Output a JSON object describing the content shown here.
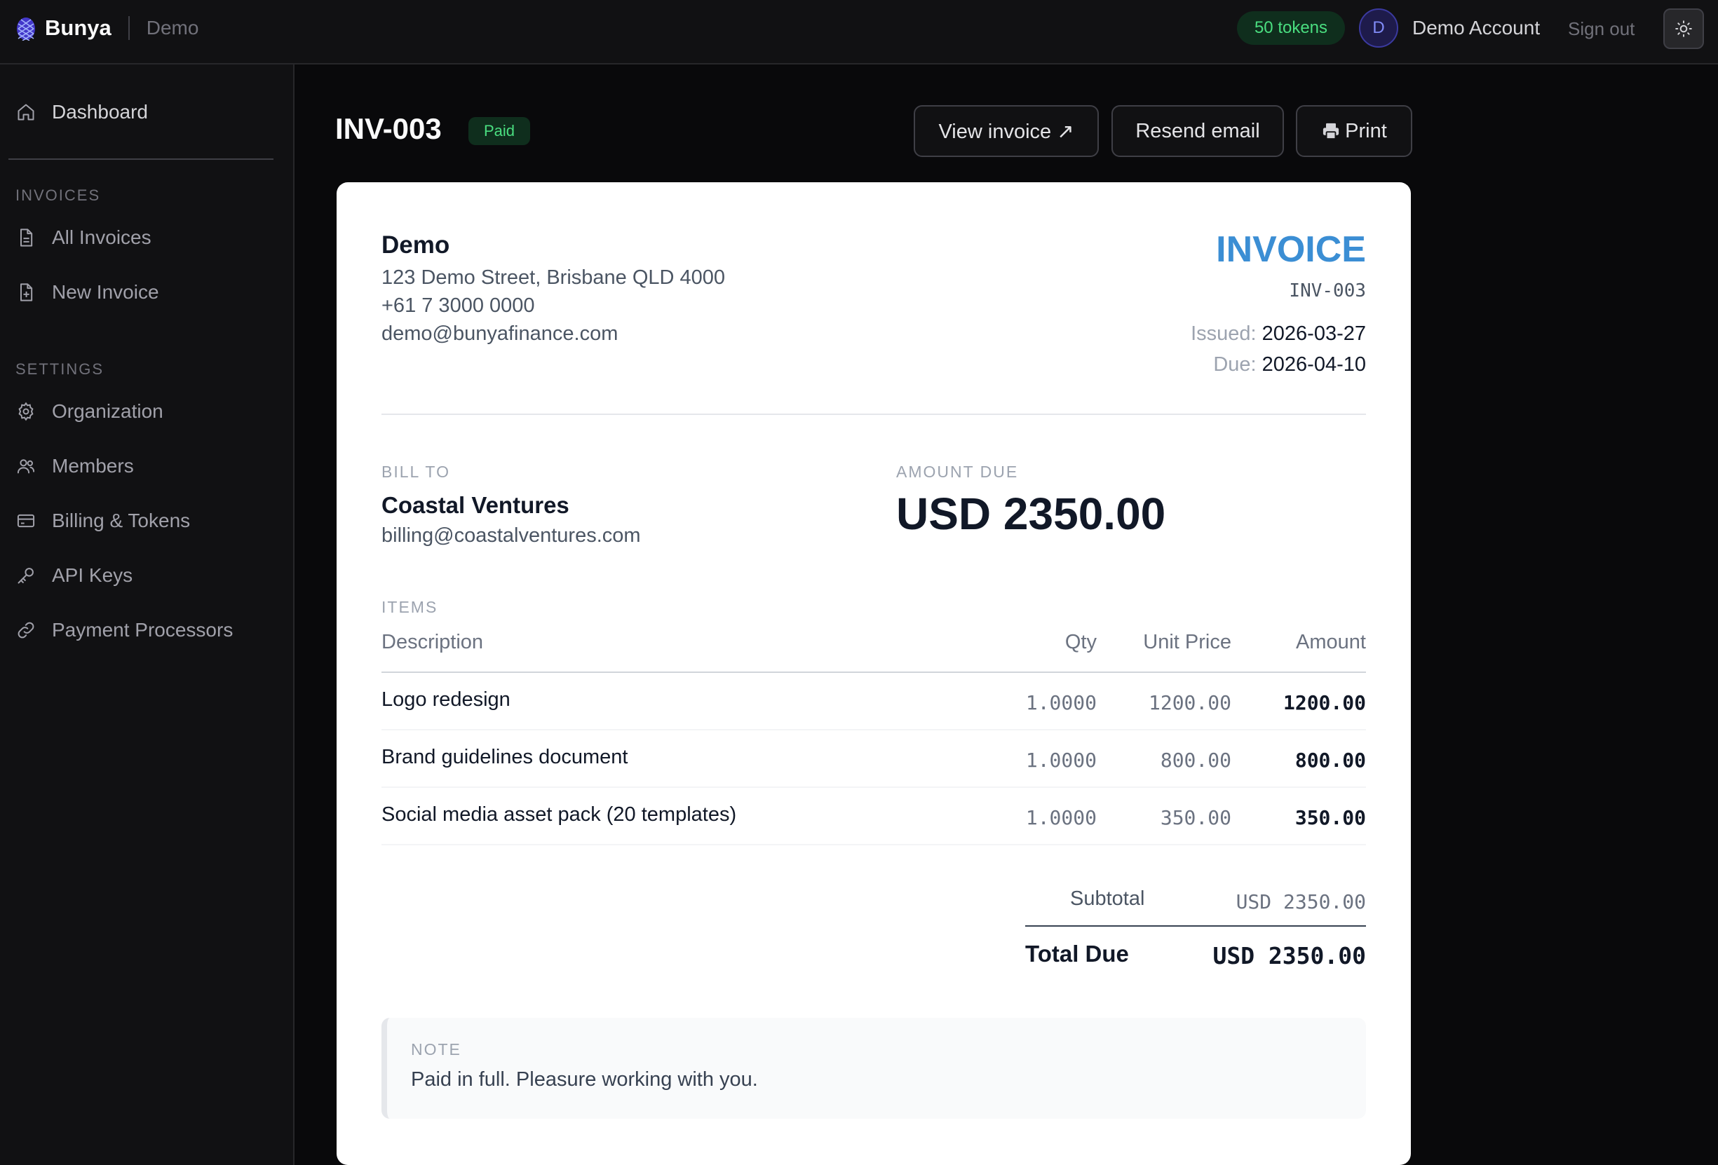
{
  "header": {
    "brand": "Bunya",
    "workspace": "Demo",
    "tokens": "50 tokens",
    "avatar_initial": "D",
    "account_name": "Demo Account",
    "signout": "Sign out",
    "theme_icon": "sun-icon"
  },
  "sidebar": {
    "top_item": {
      "label": "Dashboard",
      "icon": "home-icon"
    },
    "invoices_title": "INVOICES",
    "invoices_items": [
      {
        "label": "All Invoices",
        "icon": "file-icon"
      },
      {
        "label": "New Invoice",
        "icon": "file-plus-icon"
      }
    ],
    "settings_title": "SETTINGS",
    "settings_items": [
      {
        "label": "Organization",
        "icon": "gear-icon"
      },
      {
        "label": "Members",
        "icon": "users-icon"
      },
      {
        "label": "Billing & Tokens",
        "icon": "credit-card-icon"
      },
      {
        "label": "API Keys",
        "icon": "key-icon"
      },
      {
        "label": "Payment Processors",
        "icon": "link-icon"
      }
    ]
  },
  "page": {
    "title": "INV-003",
    "status": "Paid",
    "actions": {
      "view": "View invoice ↗",
      "resend": "Resend email",
      "print": "Print"
    }
  },
  "invoice": {
    "from": {
      "name": "Demo",
      "address": "123 Demo Street, Brisbane QLD 4000",
      "phone": "+61 7 3000 0000",
      "email": "demo@bunyafinance.com"
    },
    "heading": "INVOICE",
    "number": "INV-003",
    "issued_label": "Issued:",
    "issued": "2026-03-27",
    "due_label": "Due:",
    "due": "2026-04-10",
    "bill_to_label": "BILL TO",
    "bill_to_name": "Coastal Ventures",
    "bill_to_email": "billing@coastalventures.com",
    "amount_due_label": "AMOUNT DUE",
    "amount_due": "USD 2350.00",
    "items_label": "ITEMS",
    "columns": {
      "description": "Description",
      "qty": "Qty",
      "unit_price": "Unit Price",
      "amount": "Amount"
    },
    "items": [
      {
        "description": "Logo redesign",
        "qty": "1.0000",
        "unit_price": "1200.00",
        "amount": "1200.00"
      },
      {
        "description": "Brand guidelines document",
        "qty": "1.0000",
        "unit_price": "800.00",
        "amount": "800.00"
      },
      {
        "description": "Social media asset pack (20 templates)",
        "qty": "1.0000",
        "unit_price": "350.00",
        "amount": "350.00"
      }
    ],
    "subtotal_label": "Subtotal",
    "subtotal": "USD 2350.00",
    "total_label": "Total Due",
    "total": "USD 2350.00",
    "note_label": "NOTE",
    "note": "Paid in full. Pleasure working with you."
  },
  "colors": {
    "accent": "#3b8ed4",
    "paid_green": "#4ade80",
    "avatar_indigo": "#818cf8",
    "background": "#09090b"
  }
}
